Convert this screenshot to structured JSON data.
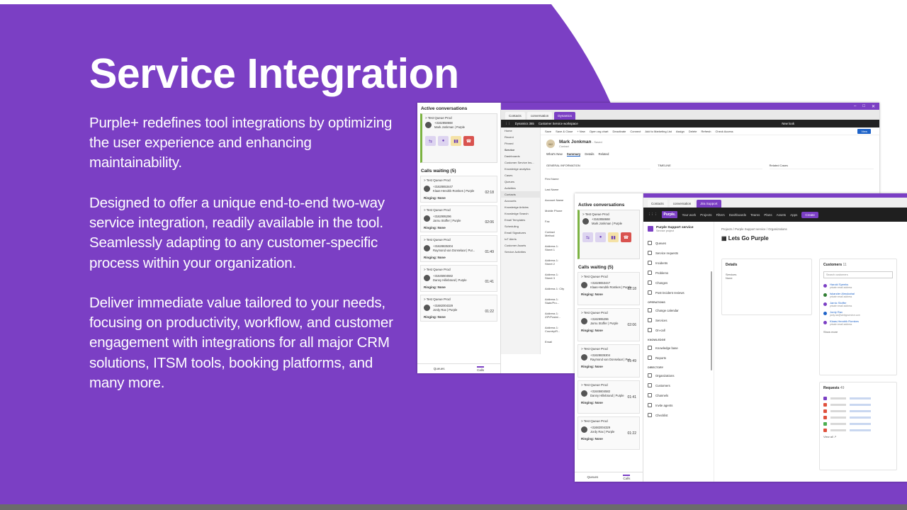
{
  "slide": {
    "title": "Service Integration",
    "paragraphs": [
      "Purple+ redefines tool integrations by optimizing the user experience and enhancing maintainability.",
      "Designed to offer a unique end-to-end two-way service integration, readily available in the tool. Seamlessly adapting to any customer-specific process within your organization.",
      "Deliver immediate value tailored to your needs, focusing on productivity, workflow, and customer engagement with integrations for all major CRM solutions, ITSM tools, booking platforms, and many more."
    ],
    "colors": {
      "purple": "#7b3fc4",
      "text": "#ffffff"
    }
  },
  "panel": {
    "active_title": "Active conversations",
    "active_queue": "> Test Queue Prod",
    "active_number": "+3162858668",
    "active_name": "Mark Jonkman | Purple",
    "waiting_title": "Calls waiting (5)",
    "ringing": "Ringing: None",
    "tab_queues": "Queues",
    "tab_calls": "Calls",
    "calls": [
      {
        "queue": "> Test Queue Prod",
        "number": "+31628653447",
        "name": "Klaas-Hendrik Romkes | Purple",
        "time": "02:18"
      },
      {
        "queue": "> Test Queue Prod",
        "number": "+3162995296",
        "name": "Jarnu Stoffer | Purple",
        "time": "02:06"
      },
      {
        "queue": "> Test Queue Prod",
        "number": "+31628835304",
        "name": "Raymond van Donselaar | Pur...",
        "time": "01:49"
      },
      {
        "queue": "> Test Queue Prod",
        "number": "+31645604582",
        "name": "Danny Hillebrand | Purple",
        "time": "01:41"
      },
      {
        "queue": "> Test Queue Prod",
        "number": "+31682004329",
        "name": "Jordy Rax | Purple",
        "time": "01:22"
      }
    ]
  },
  "dynamics": {
    "tabs": [
      "Contacts",
      "conversation",
      "Dynamics"
    ],
    "app_name": "Dynamics 365",
    "workspace": "Customer Service workspace",
    "new_look": "New look",
    "nav": [
      "Home",
      "Recent",
      "Pinned",
      "Service",
      "Dashboards",
      "Customer Service Ins...",
      "Knowledge analytics",
      "Cases",
      "Queues",
      "Activities",
      "Contacts",
      "Accounts",
      "Knowledge Articles",
      "Knowledge Search",
      "Email Templates",
      "Scheduling",
      "Email Signatures",
      "IoT Alerts",
      "Customer Assets",
      "Service Activities"
    ],
    "commands": [
      "Save",
      "Save & Close",
      "+ New",
      "Open org chart",
      "Deactivate",
      "Connect",
      "Add to Marketing List",
      "Assign",
      "Delete",
      "Refresh",
      "Check Access"
    ],
    "view_button": "View",
    "contact_initials": "MJ",
    "contact_name": "Mark Jonkman",
    "contact_saved": "- Saved",
    "contact_type": "Contact",
    "record_tabs": [
      "What's New",
      "Summary",
      "Details",
      "Related"
    ],
    "sections": [
      "GENERAL INFORMATION",
      "TIMELINE",
      "Related Cases"
    ],
    "fields": [
      "First Name",
      "Last Name",
      "Account Name",
      "Mobile Phone",
      "Fax",
      "Contact Method",
      "Address 1: Street 1",
      "Address 1: Street 2",
      "Address 1: Street 3",
      "Address 1: City",
      "Address 1: State/Pro...",
      "Address 1: ZIP/Postal...",
      "Address 1: Country/R...",
      "Email"
    ]
  },
  "jira": {
    "tabs": [
      "Contacts",
      "conversation",
      "Jira Support"
    ],
    "logo": "Purple.",
    "nav": [
      "Your work",
      "Projects",
      "Filters",
      "Dashboards",
      "Teams",
      "Plans",
      "Assets",
      "Apps"
    ],
    "create": "Create",
    "project_name": "Purple Support service",
    "project_type": "Service project",
    "links": [
      "Queues",
      "Service requests",
      "Incidents",
      "Problems",
      "Changes",
      "Post-incident reviews"
    ],
    "operations_title": "OPERATIONS",
    "operations": [
      "Change calendar",
      "Services",
      "On-call"
    ],
    "knowledge_title": "KNOWLEDGE",
    "knowledge": [
      "Knowledge base",
      "Reports"
    ],
    "directory_title": "DIRECTORY",
    "directory": [
      "Organizations",
      "Customers",
      "Channels",
      "Invite agents",
      "Checklist"
    ],
    "breadcrumb": "Projects  /  Purple Support service  /  Organizations",
    "page_title": "Lets Go Purple",
    "details_title": "Details",
    "details_label": "Services",
    "details_value": "None",
    "customers_title": "Customers",
    "customers_count": "11",
    "customers_search": "Search customers",
    "customers": [
      {
        "name": "Harold Speeks",
        "email": "private email address"
      },
      {
        "name": "Iskander Almukahal",
        "email": "private email address"
      },
      {
        "name": "Jarnic Stoffer",
        "email": "private email address"
      },
      {
        "name": "Jordy Rax",
        "email": "jordy.rax@whitppservice.com"
      },
      {
        "name": "Klaas-Hendrik Romkes",
        "email": "private email address"
      }
    ],
    "show_more": "Show more",
    "requests_title": "Requests",
    "requests_count": "49",
    "view_all": "View all"
  }
}
